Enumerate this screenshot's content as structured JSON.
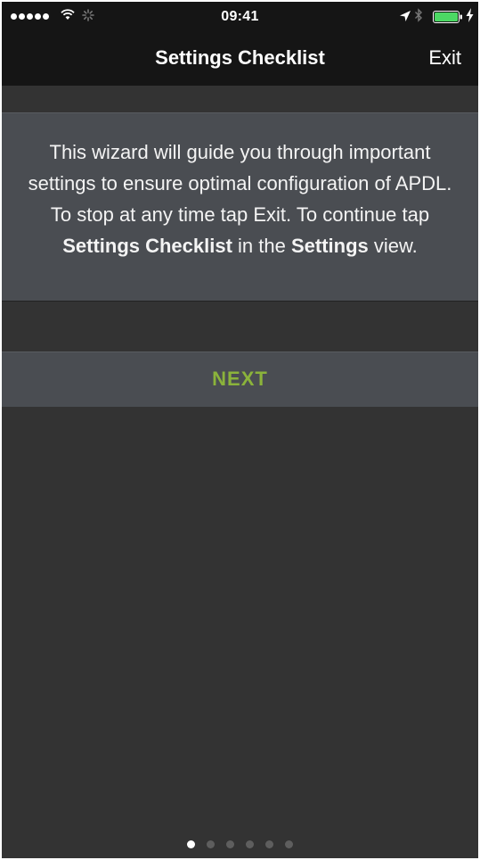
{
  "status_bar": {
    "time": "09:41",
    "signal_bars": 5,
    "battery_level": 1.0,
    "icons": [
      "signal-dots",
      "wifi-icon",
      "activity-icon",
      "location-icon",
      "bluetooth-icon",
      "battery-icon",
      "charging-icon"
    ]
  },
  "nav": {
    "title": "Settings Checklist",
    "exit_label": "Exit"
  },
  "info": {
    "line1": "This wizard will guide you through important settings to ensure optimal configuration of APDL. To stop at any time tap Exit. To continue tap ",
    "bold1": "Settings Checklist",
    "line2": " in the ",
    "bold2": "Settings",
    "line3": " view."
  },
  "next_label": "NEXT",
  "pager": {
    "total_pages": 6,
    "current_page": 1
  },
  "colors": {
    "background": "#333333",
    "bar": "#151515",
    "panel": "#4a4d52",
    "accent_green": "#8bb33b",
    "battery_green": "#4cd964"
  }
}
